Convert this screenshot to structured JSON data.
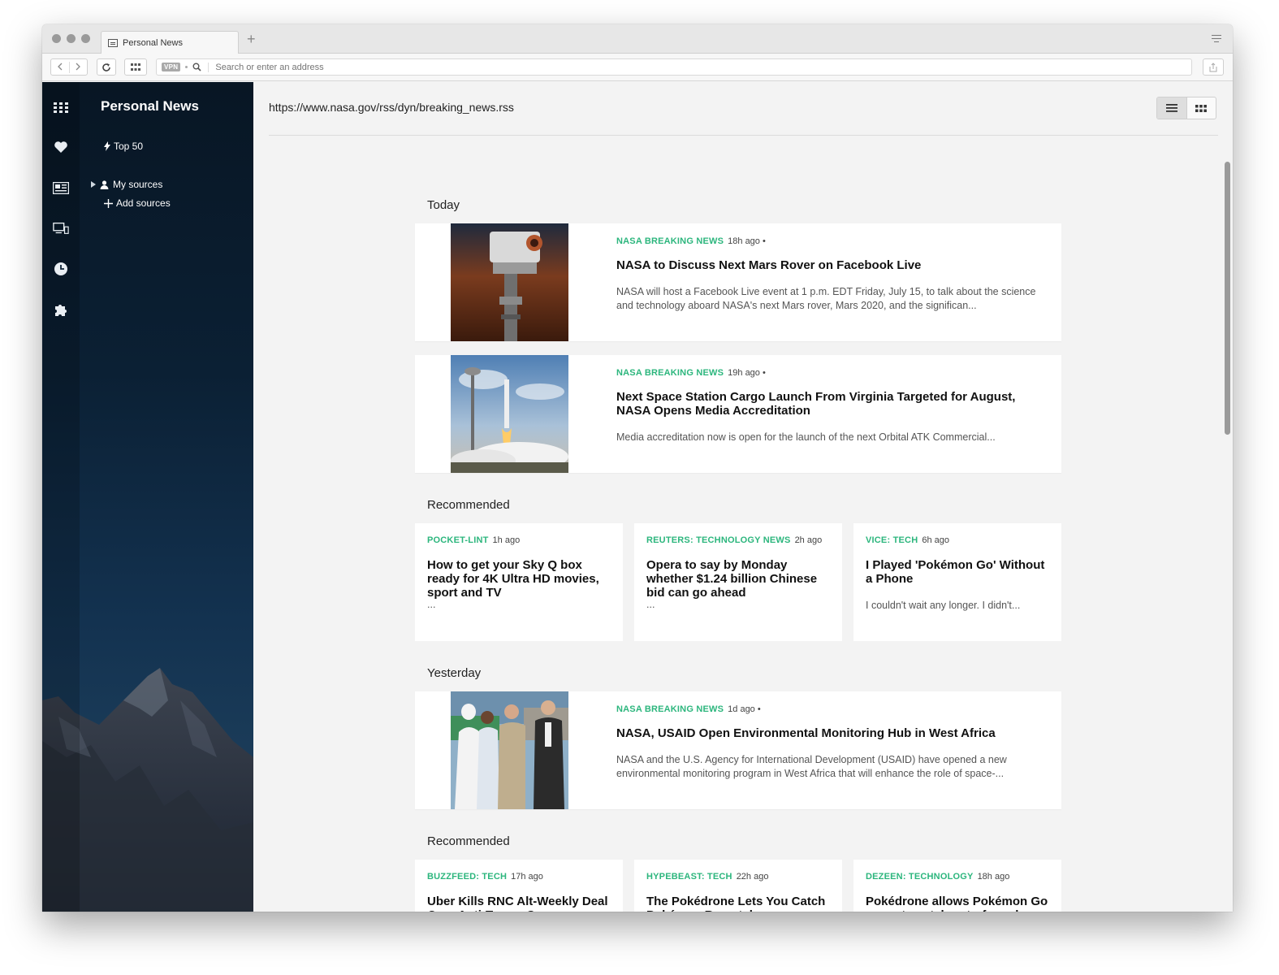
{
  "browser": {
    "tab_title": "Personal News",
    "vpn_badge": "VPN",
    "address_placeholder": "Search or enter an address"
  },
  "sidebar": {
    "title": "Personal News",
    "top50": "Top 50",
    "my_sources": "My sources",
    "add_sources": "Add sources"
  },
  "main": {
    "feed_url": "https://www.nasa.gov/rss/dyn/breaking_news.rss",
    "sections": {
      "today": "Today",
      "recommended_1": "Recommended",
      "yesterday": "Yesterday",
      "recommended_2": "Recommended"
    },
    "today_articles": [
      {
        "source": "NASA BREAKING NEWS",
        "ago": "18h ago •",
        "title": "NASA to Discuss Next Mars Rover on Facebook Live",
        "excerpt": "NASA will host a Facebook Live event at 1 p.m. EDT Friday, July 15, to talk about the science and technology aboard NASA's next Mars rover, Mars 2020, and the significan..."
      },
      {
        "source": "NASA BREAKING NEWS",
        "ago": "19h ago •",
        "title": "Next Space Station Cargo Launch From Virginia Targeted for August, NASA Opens Media Accreditation",
        "excerpt": "Media accreditation now is open for the launch of the next Orbital ATK Commercial..."
      }
    ],
    "recommended_1": [
      {
        "source": "POCKET-LINT",
        "ago": "1h ago",
        "title": "How to get your Sky Q box ready for 4K Ultra HD movies, sport and TV",
        "excerpt": "..."
      },
      {
        "source": "REUTERS: TECHNOLOGY NEWS",
        "ago": "2h ago",
        "title": "Opera to say by Monday whether $1.24 billion Chinese bid can go ahead",
        "excerpt": "..."
      },
      {
        "source": "VICE: TECH",
        "ago": "6h ago",
        "title": "I Played 'Pokémon Go' Without a Phone",
        "excerpt": "I couldn't wait any longer. I didn't..."
      }
    ],
    "yesterday_articles": [
      {
        "source": "NASA BREAKING NEWS",
        "ago": "1d ago •",
        "title": "NASA, USAID Open Environmental Monitoring Hub in West Africa",
        "excerpt": "NASA and the U.S. Agency for International Development (USAID) have opened a new environmental monitoring program in West Africa that will enhance the role of space-..."
      }
    ],
    "recommended_2": [
      {
        "source": "BUZZFEED: TECH",
        "ago": "17h ago",
        "title": "Uber Kills RNC Alt-Weekly Deal Over Anti-Trump Cover"
      },
      {
        "source": "HYPEBEAST: TECH",
        "ago": "22h ago",
        "title": "The Pokédrone Lets You Catch Pokémon Remotely"
      },
      {
        "source": "DEZEEN: TECHNOLOGY",
        "ago": "18h ago",
        "title": "Pokédrone allows Pokémon Go users to catch out-of-reach species"
      }
    ]
  },
  "colors": {
    "source_accent": "#2cb67d",
    "sidebar_top": "#081624",
    "sidebar_bottom": "#1c3550",
    "page_bg": "#f3f3f3"
  },
  "icons": {
    "rail": [
      "speed-dial-icon",
      "heart-icon",
      "news-icon",
      "devices-icon",
      "history-icon",
      "extensions-icon"
    ],
    "toggles": [
      "list-view-icon",
      "grid-view-icon"
    ]
  }
}
